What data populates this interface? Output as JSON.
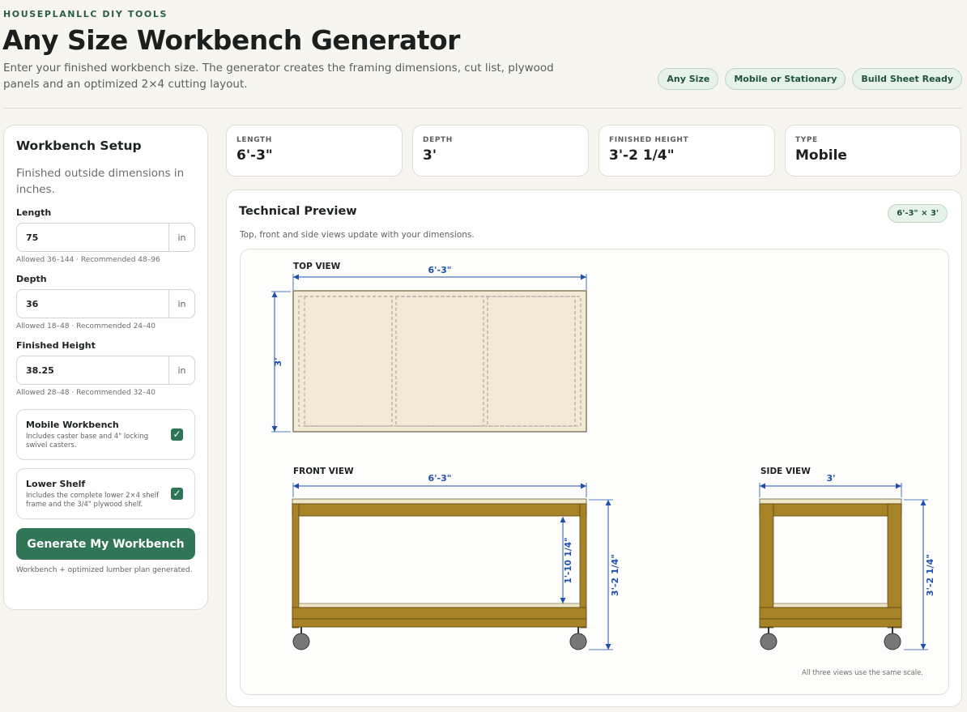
{
  "header": {
    "eyebrow": "HOUSEPLANLLC DIY TOOLS",
    "title": "Any Size Workbench Generator",
    "subtitle": "Enter your finished workbench size. The generator creates the framing dimensions, cut list, plywood panels and an optimized 2×4 cutting layout.",
    "pills": [
      "Any Size",
      "Mobile or Stationary",
      "Build Sheet Ready"
    ]
  },
  "setup": {
    "title": "Workbench Setup",
    "description": "Finished outside dimensions in inches.",
    "fields": [
      {
        "label": "Length",
        "value": "75",
        "unit": "in",
        "hint": "Allowed 36–144 · Recommended 48–96"
      },
      {
        "label": "Depth",
        "value": "36",
        "unit": "in",
        "hint": "Allowed 18–48 · Recommended 24–40"
      },
      {
        "label": "Finished Height",
        "value": "38.25",
        "unit": "in",
        "hint": "Allowed 28–48 · Recommended 32–40"
      }
    ],
    "options": [
      {
        "name": "Mobile Workbench",
        "text": "Includes caster base and 4\" locking swivel casters.",
        "checked": true
      },
      {
        "name": "Lower Shelf",
        "text": "Includes the complete lower 2×4 shelf frame and the 3/4\" plywood shelf.",
        "checked": true
      }
    ],
    "generate_label": "Generate My Workbench",
    "status": "Workbench + optimized lumber plan generated."
  },
  "stats": [
    {
      "label": "LENGTH",
      "value": "6'-3\""
    },
    {
      "label": "DEPTH",
      "value": "3'"
    },
    {
      "label": "FINISHED HEIGHT",
      "value": "3'-2 1/4\""
    },
    {
      "label": "TYPE",
      "value": "Mobile"
    }
  ],
  "preview": {
    "title": "Technical Preview",
    "description": "Top, front and side views update with your dimensions.",
    "size_badge": "6'-3\" × 3'",
    "top_view": {
      "label": "TOP VIEW",
      "length_dim": "6'-3\"",
      "depth_dim": "3'"
    },
    "front_view": {
      "label": "FRONT VIEW",
      "length_dim": "6'-3\"",
      "shelf_dim": "1'-10 1/4\"",
      "height_dim": "3'-2 1/4\""
    },
    "side_view": {
      "label": "SIDE VIEW",
      "depth_dim": "3'",
      "height_dim": "3'-2 1/4\""
    },
    "scale_note": "All three views use the same scale."
  },
  "colors": {
    "accent": "#2f7556",
    "dimension": "#1f4fb0",
    "wood": "#a88227",
    "plywood": "#f3ead6"
  }
}
